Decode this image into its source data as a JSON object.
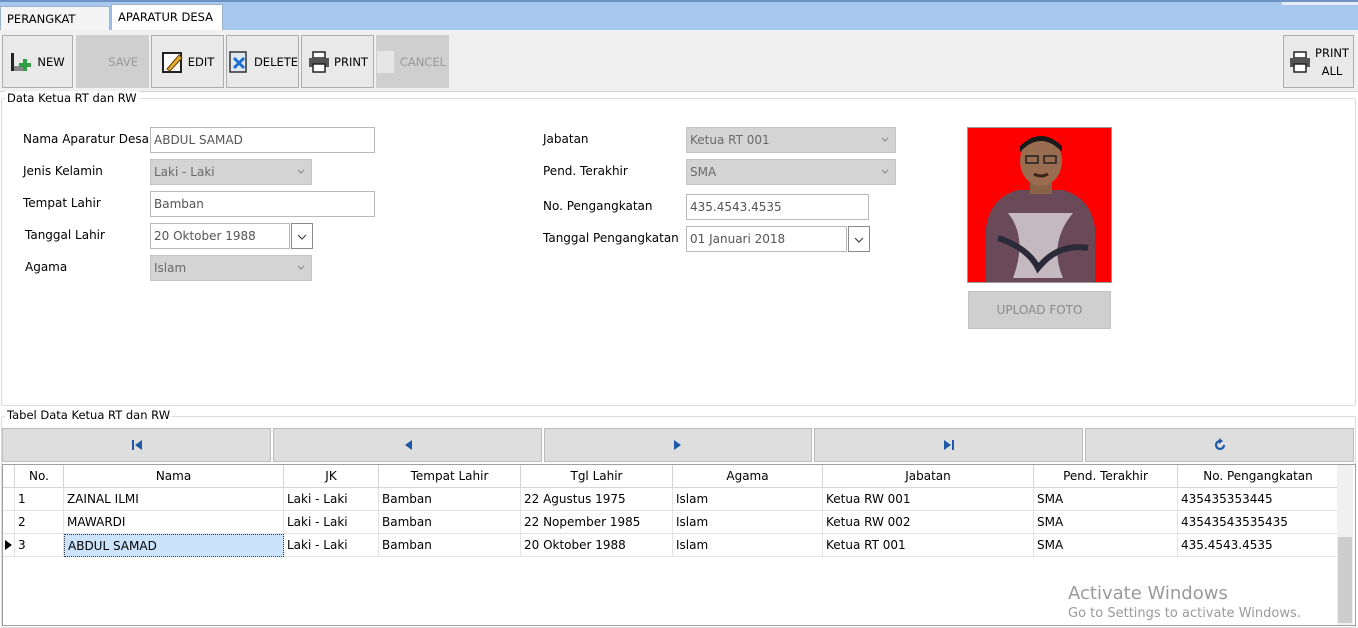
{
  "tabs": [
    {
      "label": "PERANGKAT DESA"
    },
    {
      "label": "APARATUR DESA"
    }
  ],
  "toolbar": {
    "new": "NEW",
    "save": "SAVE",
    "edit": "EDIT",
    "delete": "DELETE",
    "print": "PRINT",
    "cancel": "CANCEL",
    "print_all_1": "PRINT",
    "print_all_2": "ALL"
  },
  "form": {
    "title": "Data Ketua RT dan RW",
    "nama_label": "Nama Aparatur Desa",
    "nama_value": "ABDUL SAMAD",
    "jk_label": "Jenis Kelamin",
    "jk_value": "Laki - Laki",
    "tempat_label": "Tempat Lahir",
    "tempat_value": "Bamban",
    "tgl_label": "Tanggal Lahir",
    "tgl_value": "20 Oktober 1988",
    "agama_label": "Agama",
    "agama_value": "Islam",
    "jabatan_label": "Jabatan",
    "jabatan_value": "Ketua RT 001",
    "pend_label": "Pend. Terakhir",
    "pend_value": "SMA",
    "nopeng_label": "No. Pengangkatan",
    "nopeng_value": "435.4543.4535",
    "tglpeng_label": "Tanggal Pengangkatan",
    "tglpeng_value": "01 Januari 2018",
    "upload_label": "UPLOAD FOTO"
  },
  "table": {
    "title": "Tabel Data Ketua RT dan RW",
    "columns": [
      "No.",
      "Nama",
      "JK",
      "Tempat Lahir",
      "Tgl Lahir",
      "Agama",
      "Jabatan",
      "Pend. Terakhir",
      "No. Pengangkatan"
    ],
    "rows": [
      [
        "1",
        "ZAINAL ILMI",
        "Laki - Laki",
        "Bamban",
        "22 Agustus 1975",
        "Islam",
        "Ketua RW 001",
        "SMA",
        "435435353445"
      ],
      [
        "2",
        "MAWARDI",
        "Laki - Laki",
        "Bamban",
        "22 Nopember 1985",
        "Islam",
        "Ketua RW 002",
        "SMA",
        "43543543535435"
      ],
      [
        "3",
        "ABDUL SAMAD",
        "Laki - Laki",
        "Bamban",
        "20 Oktober 1988",
        "Islam",
        "Ketua RT 001",
        "SMA",
        "435.4543.4535"
      ]
    ],
    "current_row": 3
  },
  "watermark": {
    "line1": "Activate Windows",
    "line2": "Go to Settings to activate Windows."
  },
  "colors": {
    "tab_strip": "#a6c8ee",
    "photo_bg": "#ff0000",
    "nav_icon": "#1e5aa8",
    "selected_cell": "#cce4fb"
  }
}
